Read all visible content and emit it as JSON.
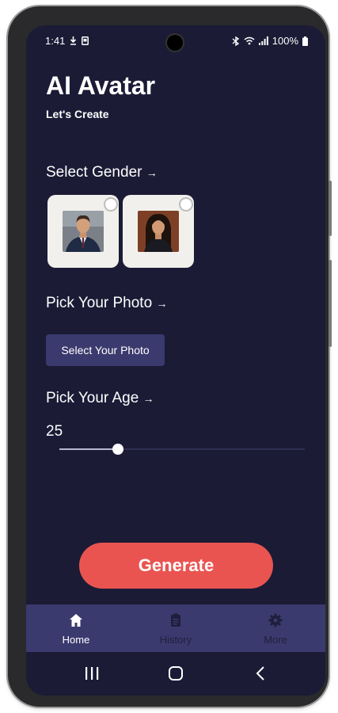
{
  "status_bar": {
    "time": "1:41",
    "battery": "100%"
  },
  "header": {
    "title": "AI Avatar",
    "subtitle": "Let's Create"
  },
  "gender": {
    "label": "Select Gender",
    "arrow": "→",
    "options": [
      "male",
      "female"
    ]
  },
  "photo": {
    "label": "Pick Your Photo",
    "arrow": "→",
    "button_label": "Select Your Photo"
  },
  "age": {
    "label": "Pick Your Age",
    "arrow": "→",
    "value": "25",
    "slider_fraction": 0.24
  },
  "generate": {
    "label": "Generate"
  },
  "nav": {
    "items": [
      {
        "label": "Home",
        "icon": "home-icon",
        "active": true
      },
      {
        "label": "History",
        "icon": "history-icon",
        "active": false
      },
      {
        "label": "More",
        "icon": "gear-icon",
        "active": false
      }
    ]
  },
  "colors": {
    "background": "#1b1b36",
    "accent": "#e95451",
    "button": "#3b3a6e",
    "nav_active": "#ffffff",
    "nav_inactive": "#1f1f3d"
  }
}
